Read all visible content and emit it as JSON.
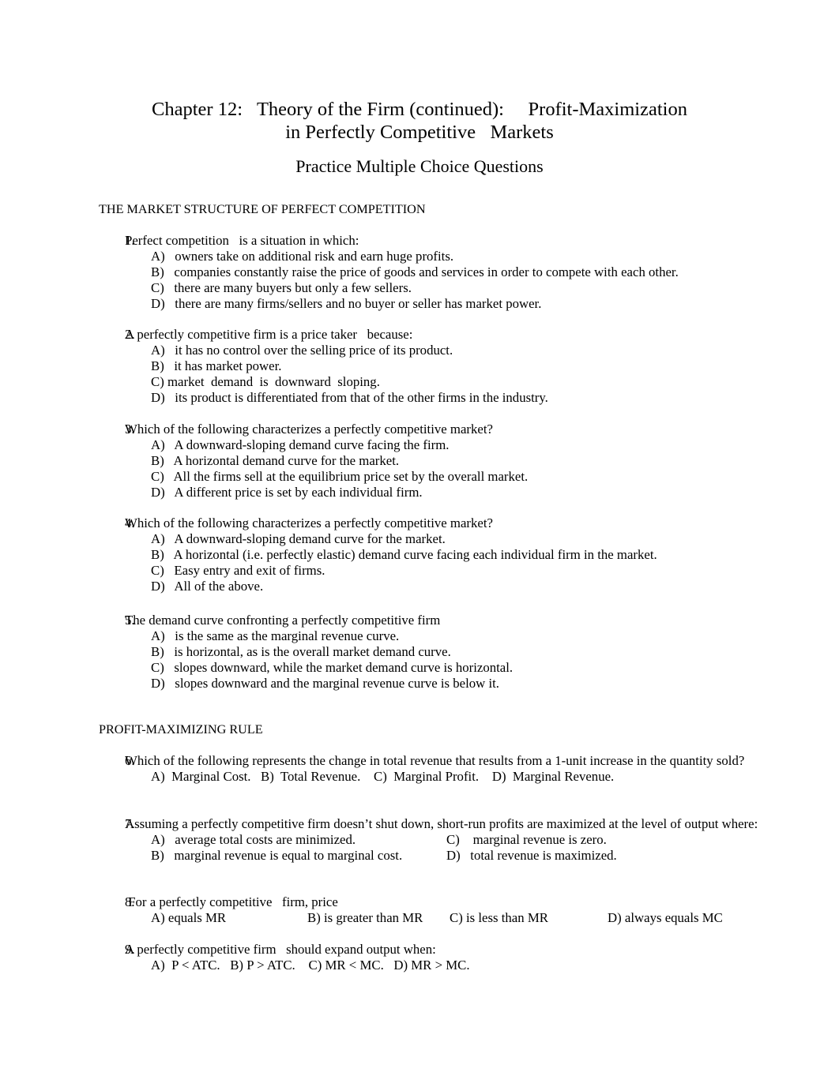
{
  "document": {
    "title_line_1": "Chapter 12:   Theory of the Firm (continued):     Profit-Maximization",
    "title_line_2": "in Perfectly Competitive   Markets",
    "subtitle": "Practice Multiple Choice Questions"
  },
  "sections": [
    {
      "heading": "THE MARKET STRUCTURE OF PERFECT COMPETITION"
    },
    {
      "heading": "PROFIT-MAXIMIZING RULE"
    }
  ],
  "questions": [
    {
      "number": "1.",
      "stem": "Perfect competition   is a situation in which:",
      "options": [
        "A)   owners take on additional risk and earn huge profits.",
        "B)   companies constantly raise the price of goods and services in order to compete with each other.",
        "C)   there are many buyers but only a few sellers.",
        "D)   there are many firms/sellers and no buyer or seller has market power."
      ]
    },
    {
      "number": "2.",
      "stem": "A perfectly competitive firm is a price taker   because:",
      "options": [
        "A)   it has no control over the selling price of its product.",
        "B)   it has market power.",
        "C) market  demand  is  downward  sloping.",
        "D)   its product is differentiated from that of the other firms in the industry."
      ]
    },
    {
      "number": "3.",
      "stem": "Which of the following characterizes a perfectly competitive market?",
      "options": [
        "A)   A downward-sloping demand curve facing the firm.",
        "B)   A horizontal demand curve for the market.",
        "C)   All the firms sell at the equilibrium price set by the overall market.",
        "D)   A different price is set by each individual firm."
      ]
    },
    {
      "number": "4.",
      "stem": "Which of the following characterizes a perfectly competitive market?",
      "options": [
        "A)   A downward-sloping demand curve for the market.",
        "B)   A horizontal (i.e. perfectly elastic) demand curve facing each individual firm in the market.",
        "C)   Easy entry and exit of firms.",
        "D)   All of the above."
      ]
    },
    {
      "number": "5.",
      "stem": "The demand curve confronting a perfectly competitive firm",
      "options": [
        "A)   is the same as the marginal revenue curve.",
        "B)   is horizontal, as is the overall market demand curve.",
        "C)   slopes downward, while the market demand curve is horizontal.",
        "D)   slopes downward and the marginal revenue curve is below it."
      ]
    },
    {
      "number": "6.",
      "stem": "Which of the following represents the change in total revenue that results from a 1-unit increase in the quantity sold?",
      "options": [
        "A)  Marginal Cost.   B)  Total Revenue.    C)  Marginal Profit.    D)  Marginal Revenue."
      ]
    },
    {
      "number": "7.",
      "stem": "Assuming a perfectly competitive firm doesn’t shut down, short-run profits are maximized at the level of output where:",
      "options_grid": [
        {
          "left": "A)   average total costs are minimized.",
          "right": "C)    marginal revenue is zero."
        },
        {
          "left": "B)   marginal revenue is equal to marginal cost.",
          "right": "D)   total revenue is maximized."
        }
      ]
    },
    {
      "number": "8.",
      "stem": " For a perfectly competitive   firm, price",
      "options_inline": [
        "A) equals MR",
        "B) is greater than MR",
        "C) is less than MR",
        "D) always equals MC"
      ]
    },
    {
      "number": "9.",
      "stem": "A perfectly competitive firm   should expand output when:",
      "options": [
        "A)  P < ATC.   B) P > ATC.    C) MR < MC.   D) MR > MC."
      ]
    }
  ]
}
